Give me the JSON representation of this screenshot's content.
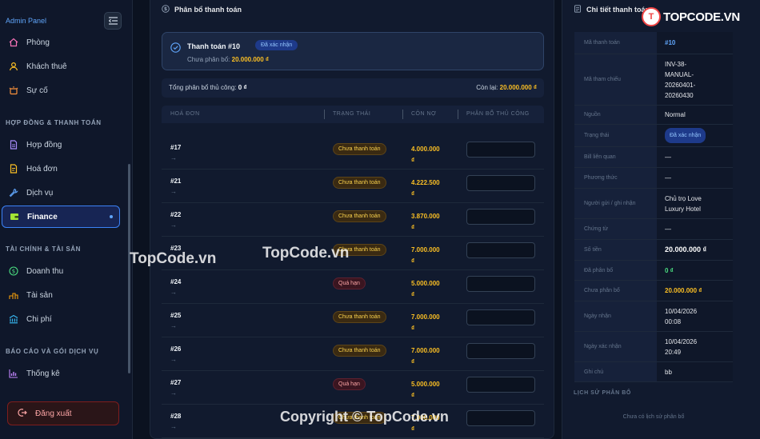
{
  "sidebar": {
    "title": "Admin Panel",
    "items_top": [
      {
        "label": "Phòng",
        "icon": "home-icon"
      },
      {
        "label": "Khách thuê",
        "icon": "user-icon"
      },
      {
        "label": "Sự cố",
        "icon": "alert-icon"
      }
    ],
    "section_contracts": "HỢP ĐỒNG & THANH TOÁN",
    "items_contracts": [
      {
        "label": "Hợp đồng",
        "icon": "contract-icon"
      },
      {
        "label": "Hoá đơn",
        "icon": "invoice-icon"
      },
      {
        "label": "Dịch vụ",
        "icon": "wrench-icon"
      },
      {
        "label": "Finance",
        "icon": "finance-icon"
      }
    ],
    "section_finance": "TÀI CHÍNH & TÀI SẢN",
    "items_finance": [
      {
        "label": "Doanh thu",
        "icon": "dollar-icon"
      },
      {
        "label": "Tài sản",
        "icon": "assets-icon"
      },
      {
        "label": "Chi phí",
        "icon": "bank-icon"
      }
    ],
    "section_reports": "BÁO CÁO VÀ GÓI DỊCH VỤ",
    "items_reports": [
      {
        "label": "Thống kê",
        "icon": "chart-icon"
      }
    ],
    "logout": "Đăng xuất"
  },
  "allocation": {
    "header": "Phân bổ thanh toán",
    "payment_title": "Thanh toán #10",
    "payment_badge": "Đã xác nhận",
    "unallocated_label": "Chưa phân bổ:",
    "unallocated_value": "20.000.000 ₫",
    "manual_total_label": "Tổng phân bổ thủ công:",
    "manual_total_value": "0 ₫",
    "remaining_label": "Còn lại:",
    "remaining_value": "20.000.000 ₫",
    "columns": [
      "HOÁ ĐƠN",
      "TRẠNG THÁI",
      "CÔN NỢ",
      "PHÂN BỔ THỦ CÔNG"
    ],
    "rows": [
      {
        "invoice": "#17",
        "status": "Chưa thanh toán",
        "kind": "unpaid",
        "debt_1": "4.000.000",
        "debt_2": "₫"
      },
      {
        "invoice": "#21",
        "status": "Chưa thanh toán",
        "kind": "unpaid",
        "debt_1": "4.222.500",
        "debt_2": "₫"
      },
      {
        "invoice": "#22",
        "status": "Chưa thanh toán",
        "kind": "unpaid",
        "debt_1": "3.870.000",
        "debt_2": "₫"
      },
      {
        "invoice": "#23",
        "status": "Chưa thanh toán",
        "kind": "unpaid",
        "debt_1": "7.000.000",
        "debt_2": "₫"
      },
      {
        "invoice": "#24",
        "status": "Quá hạn",
        "kind": "overdue",
        "debt_1": "5.000.000",
        "debt_2": "₫"
      },
      {
        "invoice": "#25",
        "status": "Chưa thanh toán",
        "kind": "unpaid",
        "debt_1": "7.000.000",
        "debt_2": "₫"
      },
      {
        "invoice": "#26",
        "status": "Chưa thanh toán",
        "kind": "unpaid",
        "debt_1": "7.000.000",
        "debt_2": "₫"
      },
      {
        "invoice": "#27",
        "status": "Quá hạn",
        "kind": "overdue",
        "debt_1": "5.000.000",
        "debt_2": "₫"
      },
      {
        "invoice": "#28",
        "status": "Chưa thanh toán",
        "kind": "unpaid",
        "debt_1": "7.000.000",
        "debt_2": "₫"
      }
    ],
    "row_arrow": "→"
  },
  "detail": {
    "header": "Chi tiết thanh toán",
    "rows": [
      {
        "key": "Mã thanh toán",
        "value": "#10",
        "style": "link"
      },
      {
        "key": "Mã tham chiếu",
        "value": "INV-38-\nMANUAL-\n20260401-\n20260430",
        "style": "multi"
      },
      {
        "key": "Nguồn",
        "value": "Normal",
        "style": ""
      },
      {
        "key": "Trạng thái",
        "value": "Đã xác nhận",
        "style": "badge"
      },
      {
        "key": "Bill liên quan",
        "value": "—",
        "style": ""
      },
      {
        "key": "Phương thức",
        "value": "—",
        "style": ""
      },
      {
        "key": "Người gửi / ghi nhận",
        "value": "Chủ trọ Love\nLuxury Hotel",
        "style": "multi"
      },
      {
        "key": "Chứng từ",
        "value": "—",
        "style": ""
      },
      {
        "key": "Số tiền",
        "value": "20.000.000 ₫",
        "style": "amount"
      },
      {
        "key": "Đã phân bổ",
        "value": "0 ₫",
        "style": "green"
      },
      {
        "key": "Chưa phân bổ",
        "value": "20.000.000 ₫",
        "style": "orange"
      },
      {
        "key": "Ngày nhận",
        "value": "10/04/2026\n00:08",
        "style": "multi"
      },
      {
        "key": "Ngày xác nhận",
        "value": "10/04/2026\n20:49",
        "style": "multi"
      },
      {
        "key": "Ghi chú",
        "value": "bb",
        "style": ""
      }
    ],
    "history_title": "LỊCH SỬ PHÂN BỔ",
    "history_empty": "Chưa có lịch sử phân bổ"
  },
  "watermark": {
    "logo_text": "TOPCODE.VN",
    "text_1": "TopCode.vn",
    "text_2": "TopCode.vn",
    "copyright": "Copyright © TopCode.vn"
  }
}
